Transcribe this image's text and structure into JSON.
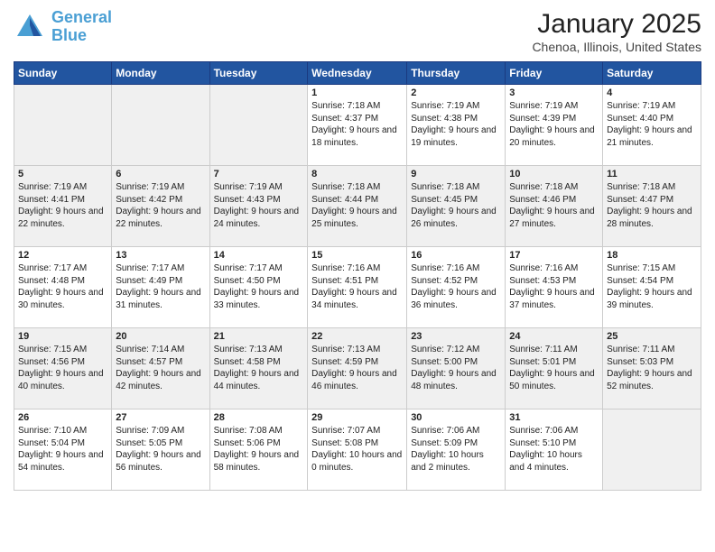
{
  "logo": {
    "line1": "General",
    "line2": "Blue"
  },
  "header": {
    "month": "January 2025",
    "location": "Chenoa, Illinois, United States"
  },
  "days_of_week": [
    "Sunday",
    "Monday",
    "Tuesday",
    "Wednesday",
    "Thursday",
    "Friday",
    "Saturday"
  ],
  "weeks": [
    [
      {
        "day": "",
        "sunrise": "",
        "sunset": "",
        "daylight": ""
      },
      {
        "day": "",
        "sunrise": "",
        "sunset": "",
        "daylight": ""
      },
      {
        "day": "",
        "sunrise": "",
        "sunset": "",
        "daylight": ""
      },
      {
        "day": "1",
        "sunrise": "Sunrise: 7:18 AM",
        "sunset": "Sunset: 4:37 PM",
        "daylight": "Daylight: 9 hours and 18 minutes."
      },
      {
        "day": "2",
        "sunrise": "Sunrise: 7:19 AM",
        "sunset": "Sunset: 4:38 PM",
        "daylight": "Daylight: 9 hours and 19 minutes."
      },
      {
        "day": "3",
        "sunrise": "Sunrise: 7:19 AM",
        "sunset": "Sunset: 4:39 PM",
        "daylight": "Daylight: 9 hours and 20 minutes."
      },
      {
        "day": "4",
        "sunrise": "Sunrise: 7:19 AM",
        "sunset": "Sunset: 4:40 PM",
        "daylight": "Daylight: 9 hours and 21 minutes."
      }
    ],
    [
      {
        "day": "5",
        "sunrise": "Sunrise: 7:19 AM",
        "sunset": "Sunset: 4:41 PM",
        "daylight": "Daylight: 9 hours and 22 minutes."
      },
      {
        "day": "6",
        "sunrise": "Sunrise: 7:19 AM",
        "sunset": "Sunset: 4:42 PM",
        "daylight": "Daylight: 9 hours and 22 minutes."
      },
      {
        "day": "7",
        "sunrise": "Sunrise: 7:19 AM",
        "sunset": "Sunset: 4:43 PM",
        "daylight": "Daylight: 9 hours and 24 minutes."
      },
      {
        "day": "8",
        "sunrise": "Sunrise: 7:18 AM",
        "sunset": "Sunset: 4:44 PM",
        "daylight": "Daylight: 9 hours and 25 minutes."
      },
      {
        "day": "9",
        "sunrise": "Sunrise: 7:18 AM",
        "sunset": "Sunset: 4:45 PM",
        "daylight": "Daylight: 9 hours and 26 minutes."
      },
      {
        "day": "10",
        "sunrise": "Sunrise: 7:18 AM",
        "sunset": "Sunset: 4:46 PM",
        "daylight": "Daylight: 9 hours and 27 minutes."
      },
      {
        "day": "11",
        "sunrise": "Sunrise: 7:18 AM",
        "sunset": "Sunset: 4:47 PM",
        "daylight": "Daylight: 9 hours and 28 minutes."
      }
    ],
    [
      {
        "day": "12",
        "sunrise": "Sunrise: 7:17 AM",
        "sunset": "Sunset: 4:48 PM",
        "daylight": "Daylight: 9 hours and 30 minutes."
      },
      {
        "day": "13",
        "sunrise": "Sunrise: 7:17 AM",
        "sunset": "Sunset: 4:49 PM",
        "daylight": "Daylight: 9 hours and 31 minutes."
      },
      {
        "day": "14",
        "sunrise": "Sunrise: 7:17 AM",
        "sunset": "Sunset: 4:50 PM",
        "daylight": "Daylight: 9 hours and 33 minutes."
      },
      {
        "day": "15",
        "sunrise": "Sunrise: 7:16 AM",
        "sunset": "Sunset: 4:51 PM",
        "daylight": "Daylight: 9 hours and 34 minutes."
      },
      {
        "day": "16",
        "sunrise": "Sunrise: 7:16 AM",
        "sunset": "Sunset: 4:52 PM",
        "daylight": "Daylight: 9 hours and 36 minutes."
      },
      {
        "day": "17",
        "sunrise": "Sunrise: 7:16 AM",
        "sunset": "Sunset: 4:53 PM",
        "daylight": "Daylight: 9 hours and 37 minutes."
      },
      {
        "day": "18",
        "sunrise": "Sunrise: 7:15 AM",
        "sunset": "Sunset: 4:54 PM",
        "daylight": "Daylight: 9 hours and 39 minutes."
      }
    ],
    [
      {
        "day": "19",
        "sunrise": "Sunrise: 7:15 AM",
        "sunset": "Sunset: 4:56 PM",
        "daylight": "Daylight: 9 hours and 40 minutes."
      },
      {
        "day": "20",
        "sunrise": "Sunrise: 7:14 AM",
        "sunset": "Sunset: 4:57 PM",
        "daylight": "Daylight: 9 hours and 42 minutes."
      },
      {
        "day": "21",
        "sunrise": "Sunrise: 7:13 AM",
        "sunset": "Sunset: 4:58 PM",
        "daylight": "Daylight: 9 hours and 44 minutes."
      },
      {
        "day": "22",
        "sunrise": "Sunrise: 7:13 AM",
        "sunset": "Sunset: 4:59 PM",
        "daylight": "Daylight: 9 hours and 46 minutes."
      },
      {
        "day": "23",
        "sunrise": "Sunrise: 7:12 AM",
        "sunset": "Sunset: 5:00 PM",
        "daylight": "Daylight: 9 hours and 48 minutes."
      },
      {
        "day": "24",
        "sunrise": "Sunrise: 7:11 AM",
        "sunset": "Sunset: 5:01 PM",
        "daylight": "Daylight: 9 hours and 50 minutes."
      },
      {
        "day": "25",
        "sunrise": "Sunrise: 7:11 AM",
        "sunset": "Sunset: 5:03 PM",
        "daylight": "Daylight: 9 hours and 52 minutes."
      }
    ],
    [
      {
        "day": "26",
        "sunrise": "Sunrise: 7:10 AM",
        "sunset": "Sunset: 5:04 PM",
        "daylight": "Daylight: 9 hours and 54 minutes."
      },
      {
        "day": "27",
        "sunrise": "Sunrise: 7:09 AM",
        "sunset": "Sunset: 5:05 PM",
        "daylight": "Daylight: 9 hours and 56 minutes."
      },
      {
        "day": "28",
        "sunrise": "Sunrise: 7:08 AM",
        "sunset": "Sunset: 5:06 PM",
        "daylight": "Daylight: 9 hours and 58 minutes."
      },
      {
        "day": "29",
        "sunrise": "Sunrise: 7:07 AM",
        "sunset": "Sunset: 5:08 PM",
        "daylight": "Daylight: 10 hours and 0 minutes."
      },
      {
        "day": "30",
        "sunrise": "Sunrise: 7:06 AM",
        "sunset": "Sunset: 5:09 PM",
        "daylight": "Daylight: 10 hours and 2 minutes."
      },
      {
        "day": "31",
        "sunrise": "Sunrise: 7:06 AM",
        "sunset": "Sunset: 5:10 PM",
        "daylight": "Daylight: 10 hours and 4 minutes."
      },
      {
        "day": "",
        "sunrise": "",
        "sunset": "",
        "daylight": ""
      }
    ]
  ]
}
